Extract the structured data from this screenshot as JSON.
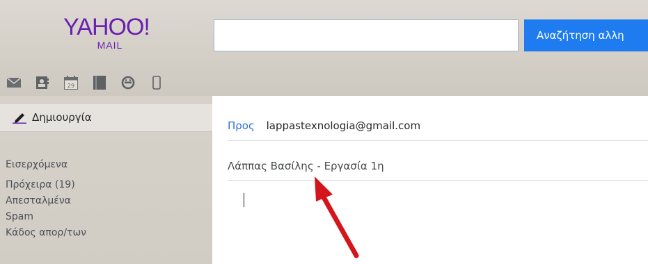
{
  "logo": {
    "brand": "YAHOO!",
    "sub": "MAIL"
  },
  "search": {
    "query": "",
    "button_label": "Αναζήτηση αλλη"
  },
  "apps": [
    "mail-icon",
    "contacts-icon",
    "calendar-icon",
    "notepad-icon",
    "messenger-icon",
    "mobile-icon"
  ],
  "calendar_day": "29",
  "sidebar": {
    "compose_label": "Δημιουργία",
    "folders": [
      {
        "label": "Εισερχόμενα"
      },
      {
        "label": "Πρόχειρα (19)"
      },
      {
        "label": "Απεσταλμένα"
      },
      {
        "label": "Spam"
      },
      {
        "label": "Κάδος απορ/των"
      }
    ]
  },
  "compose": {
    "to_label": "Προς",
    "to_value": "lappastexnologia@gmail.com",
    "subject": "Λάππας Βασίλης - Εργασία 1η"
  },
  "colors": {
    "brand": "#6b1fb1",
    "search_button": "#1e7cf0",
    "link": "#2d6ddd",
    "annotation_arrow": "#d4151b"
  }
}
